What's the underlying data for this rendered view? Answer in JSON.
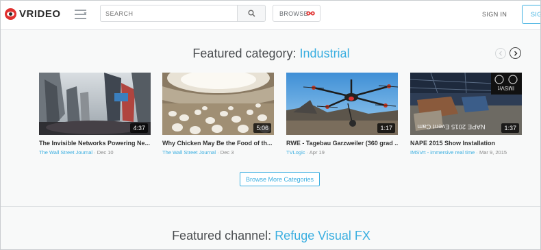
{
  "header": {
    "logo_text": "VRIDEO",
    "search_placeholder": "SEARCH",
    "browse_label": "BROWSE",
    "signin_label": "SIGN IN",
    "signup_label": "SIG"
  },
  "featured_category": {
    "prefix": "Featured category:",
    "name": "Industrial",
    "browse_more_label": "Browse More Categories",
    "videos": [
      {
        "title": "The Invisible Networks Powering Ne...",
        "source": "The Wall Street Journal",
        "date": "Dec 10",
        "duration": "4:37"
      },
      {
        "title": "Why Chicken May Be the Food of th...",
        "source": "The Wall Street Journal",
        "date": "Dec 3",
        "duration": "5:06"
      },
      {
        "title": "RWE - Tagebau Garzweiler (360 grad ...",
        "source": "TVLogic",
        "date": "Apr 19",
        "duration": "1:17"
      },
      {
        "title": "NAPE 2015 Show Installation",
        "source": "IMSVrt - immersive real time",
        "date": "Mar 9, 2015",
        "duration": "1:37"
      }
    ]
  },
  "featured_channel": {
    "prefix": "Featured channel:",
    "name": "Refuge Visual FX"
  },
  "thumb_overlays": {
    "nape_text": "NAPE 2015 Event Cam",
    "imsvrt_text": "IMSVrt"
  },
  "colors": {
    "accent": "#39aee0",
    "logo_red": "#e0312f"
  },
  "icons": [
    "logo-eye-icon",
    "menu-icon",
    "search-icon",
    "vr-goggles-icon",
    "chevron-left-icon",
    "chevron-right-icon"
  ]
}
